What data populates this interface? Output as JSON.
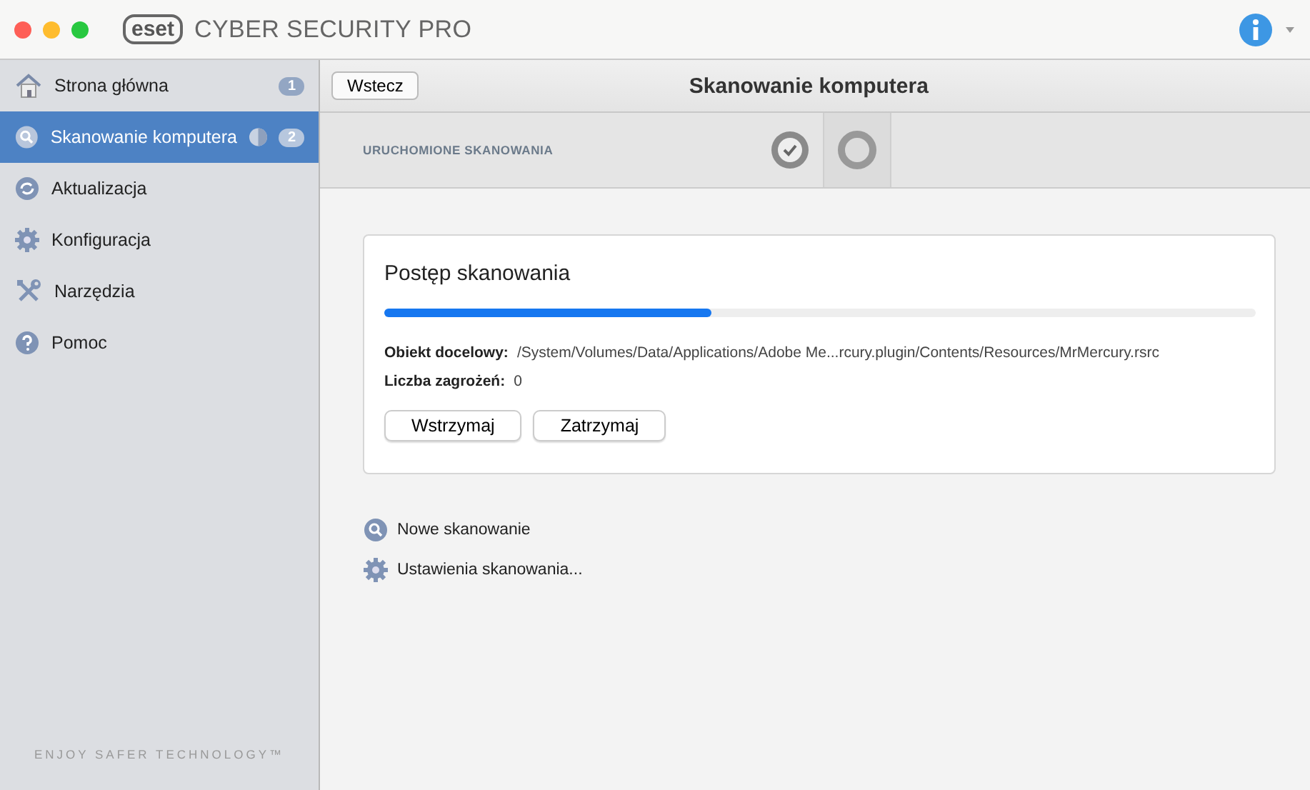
{
  "window": {
    "logo": "eset",
    "title": "CYBER SECURITY PRO"
  },
  "sidebar": {
    "items": [
      {
        "kind": "home",
        "label": "Strona główna",
        "badge": "1",
        "selected": false,
        "busy": false
      },
      {
        "kind": "search",
        "label": "Skanowanie komputera",
        "badge": "2",
        "selected": true,
        "busy": true
      },
      {
        "kind": "update",
        "label": "Aktualizacja",
        "selected": false,
        "busy": false
      },
      {
        "kind": "gear",
        "label": "Konfiguracja",
        "selected": false,
        "busy": false
      },
      {
        "kind": "tools",
        "label": "Narzędzia",
        "selected": false,
        "busy": false
      },
      {
        "kind": "help",
        "label": "Pomoc",
        "selected": false,
        "busy": false
      }
    ],
    "footer": "ENJOY SAFER TECHNOLOGY™"
  },
  "header": {
    "back": "Wstecz",
    "title": "Skanowanie komputera"
  },
  "scans": {
    "label": "URUCHOMIONE SKANOWANIA",
    "tabs": [
      {
        "kind": "done",
        "selected": false
      },
      {
        "kind": "running",
        "selected": true
      }
    ]
  },
  "progress": {
    "title": "Postęp skanowania",
    "level": 0.375,
    "fields": [
      {
        "label": "Obiekt docelowy:",
        "value": "/System/Volumes/Data/Applications/Adobe Me...rcury.plugin/Contents/Resources/MrMercury.rsrc"
      },
      {
        "label": "Liczba zagrożeń:",
        "value": "0"
      }
    ],
    "buttons": [
      "Wstrzymaj",
      "Zatrzymaj"
    ]
  },
  "links": [
    {
      "kind": "search",
      "label": "Nowe skanowanie"
    },
    {
      "kind": "gear",
      "label": "Ustawienia skanowania..."
    }
  ]
}
